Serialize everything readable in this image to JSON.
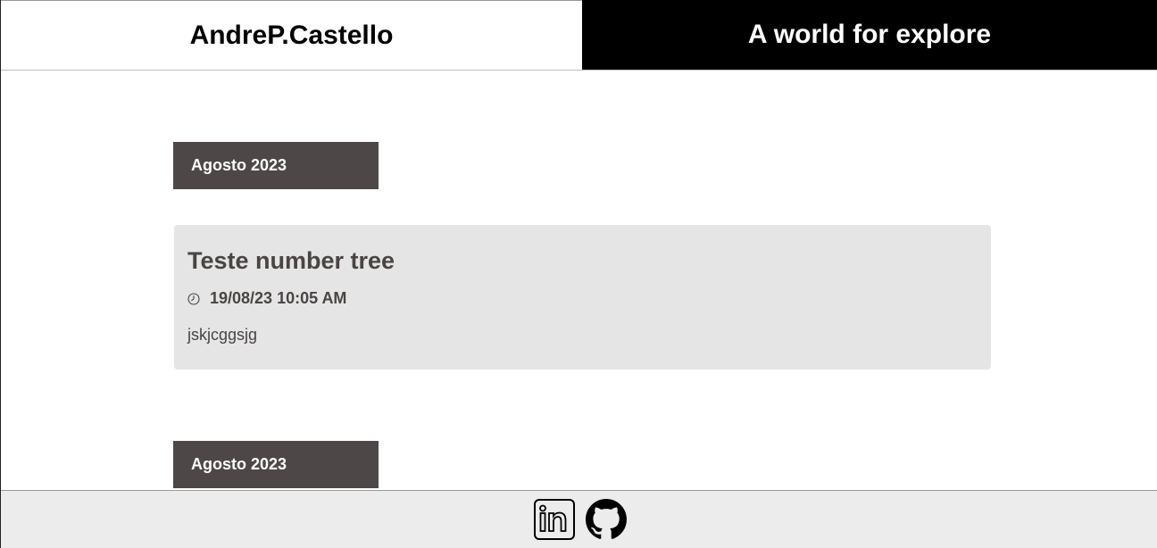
{
  "header": {
    "brand": "AndreP.Castello",
    "tagline": "A world for explore"
  },
  "posts": [
    {
      "month": "Agosto 2023",
      "title": "Teste number tree",
      "date": "19/08/23 10:05 AM",
      "body": "jskjcggsjg"
    },
    {
      "month": "Agosto 2023"
    }
  ],
  "footer": {
    "icons": [
      "linkedin-icon",
      "github-icon"
    ]
  },
  "colors": {
    "badge": "#4d4847",
    "card": "#e5e5e5",
    "header_dark": "#000000",
    "footer": "#ececec",
    "text": "#4a4443"
  }
}
